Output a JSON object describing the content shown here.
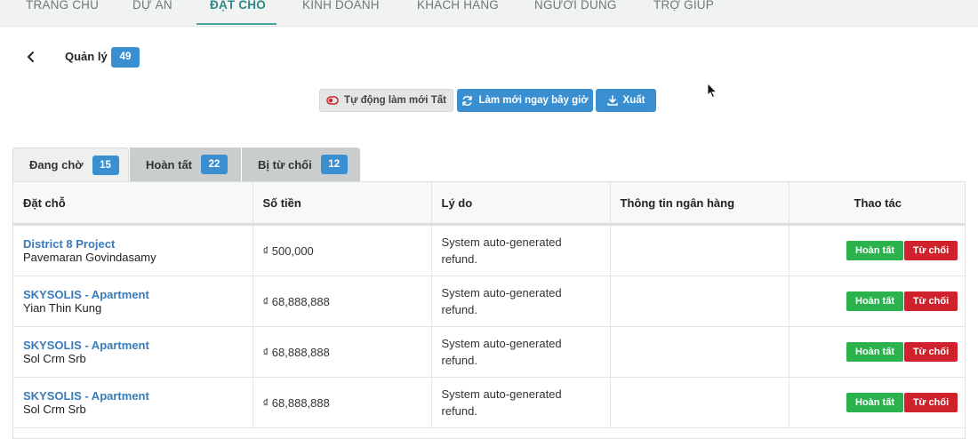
{
  "nav": {
    "items": [
      "TRANG CHỦ",
      "DỰ ÁN",
      "ĐẶT CHỖ",
      "KINH DOANH",
      "KHÁCH HÀNG",
      "NGƯỜI DÙNG",
      "TRỢ GIÚP"
    ],
    "active": "ĐẶT CHỖ"
  },
  "header": {
    "title": "Quản lý",
    "count": "49"
  },
  "toolbar": {
    "auto_refresh_label": "Tự động làm mới Tất",
    "refresh_now_label": "Làm mới ngay bây giờ",
    "export_label": "Xuất"
  },
  "tabs": [
    {
      "label": "Đang chờ",
      "count": "15"
    },
    {
      "label": "Hoàn tất",
      "count": "22"
    },
    {
      "label": "Bị từ chối",
      "count": "12"
    }
  ],
  "table": {
    "headers": [
      "Đặt chỗ",
      "Số tiền",
      "Lý do",
      "Thông tin ngân hàng",
      "Thao tác"
    ],
    "rows": [
      {
        "project": "District 8 Project",
        "customer": "Pavemaran Govindasamy",
        "amount": "₫ 500,000",
        "reason": "System auto-generated refund.",
        "bank": ""
      },
      {
        "project": "SKYSOLIS - Apartment",
        "customer": "Yian Thin Kung",
        "amount": "₫ 68,888,888",
        "reason": "System auto-generated refund.",
        "bank": ""
      },
      {
        "project": "SKYSOLIS - Apartment",
        "customer": "Sol Crm Srb",
        "amount": "₫ 68,888,888",
        "reason": "System auto-generated refund.",
        "bank": ""
      },
      {
        "project": "SKYSOLIS - Apartment",
        "customer": "Sol Crm Srb",
        "amount": "₫ 68,888,888",
        "reason": "System auto-generated refund.",
        "bank": ""
      }
    ],
    "complete_label": "Hoàn tất",
    "reject_label": "Từ chối"
  },
  "colors": {
    "accent": "#3a8fd0",
    "nav_active": "#2f8a86",
    "success": "#2bb24c",
    "danger": "#d0222d",
    "link": "#3a7ab8"
  }
}
